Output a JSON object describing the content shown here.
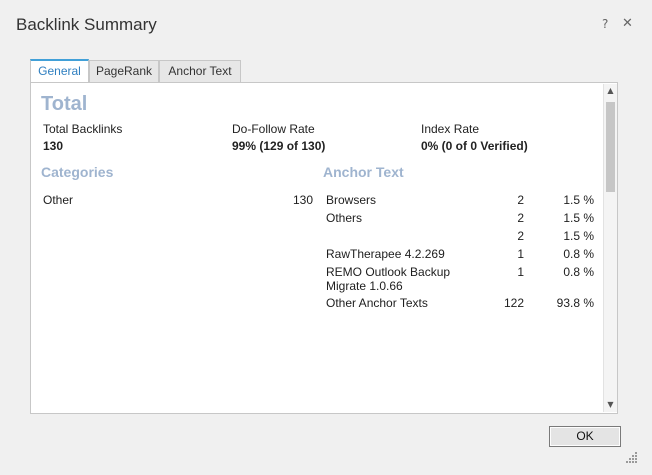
{
  "window": {
    "title": "Backlink Summary",
    "help_glyph": "?",
    "close_glyph": "✕"
  },
  "tabs": [
    {
      "label": "General",
      "active": true
    },
    {
      "label": "PageRank",
      "active": false
    },
    {
      "label": "Anchor Text",
      "active": false
    }
  ],
  "total": {
    "heading": "Total",
    "stats": [
      {
        "label": "Total Backlinks",
        "value": "130"
      },
      {
        "label": "Do-Follow Rate",
        "value": "99% (129 of 130)"
      },
      {
        "label": "Index Rate",
        "value": "0% (0 of 0 Verified)"
      }
    ]
  },
  "categories": {
    "heading": "Categories",
    "rows": [
      {
        "name": "Other",
        "count": "130"
      }
    ]
  },
  "anchor_text": {
    "heading": "Anchor Text",
    "rows": [
      {
        "name": "Browsers",
        "count": "2",
        "percent": "1.5 %"
      },
      {
        "name": "Others",
        "count": "2",
        "percent": "1.5 %"
      },
      {
        "name": "",
        "count": "2",
        "percent": "1.5 %"
      },
      {
        "name": "RawTherapee 4.2.269",
        "count": "1",
        "percent": "0.8 %"
      },
      {
        "name": "REMO Outlook Backup Migrate 1.0.66",
        "count": "1",
        "percent": "0.8 %"
      },
      {
        "name": "Other Anchor Texts",
        "count": "122",
        "percent": "93.8 %"
      }
    ]
  },
  "buttons": {
    "ok_label": "OK"
  },
  "colors": {
    "accent": "#41a0d8",
    "section_heading": "#9fb4cf"
  }
}
